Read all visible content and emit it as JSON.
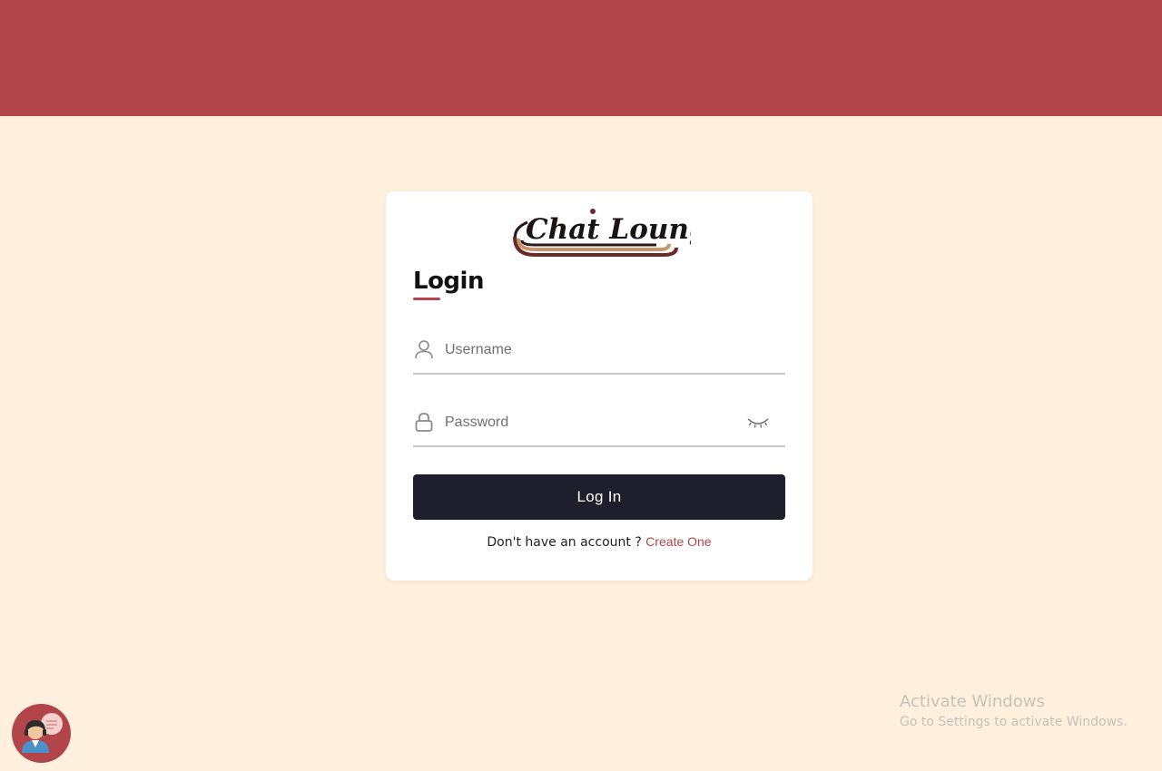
{
  "colors": {
    "header": "#b2454a",
    "background": "#fff0dd",
    "card": "#ffffff",
    "button": "#1e1e2d",
    "accent": "#b2454a"
  },
  "logo": {
    "text": "Chat Lounge"
  },
  "form": {
    "title": "Login",
    "username": {
      "placeholder": "Username",
      "value": "",
      "icon": "user-icon"
    },
    "password": {
      "placeholder": "Password",
      "value": "",
      "icon": "lock-icon",
      "toggle_icon": "eye-closed-icon"
    },
    "submit_label": "Log In",
    "signup_prompt": "Don't have an account ?",
    "signup_link": "Create One"
  },
  "chatbot": {
    "icon": "support-agent-icon"
  },
  "watermark": {
    "title": "Activate Windows",
    "subtitle": "Go to Settings to activate Windows."
  }
}
